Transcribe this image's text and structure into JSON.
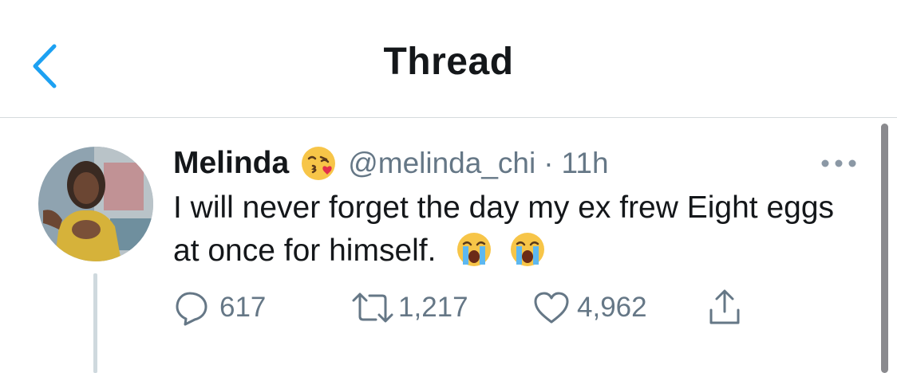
{
  "header": {
    "title": "Thread",
    "back_icon": "chevron-left-icon"
  },
  "tweet": {
    "display_name": "Melinda",
    "name_emoji": "face-blowing-a-kiss-emoji",
    "handle": "@melinda_chi",
    "separator": "·",
    "time_ago": "11h",
    "text": "I will never forget the day my ex frew Eight eggs at once for himself.",
    "text_emojis": [
      "loudly-crying-face-emoji",
      "loudly-crying-face-emoji"
    ],
    "more_icon": "more-horizontal-icon"
  },
  "actions": {
    "replies": "617",
    "retweets": "1,217",
    "likes": "4,962",
    "icons": [
      "reply-icon",
      "retweet-icon",
      "heart-icon",
      "share-icon"
    ]
  },
  "colors": {
    "accent": "#1da1f2",
    "text": "#14171a",
    "secondary": "#657786",
    "divider": "#d6dadd"
  }
}
